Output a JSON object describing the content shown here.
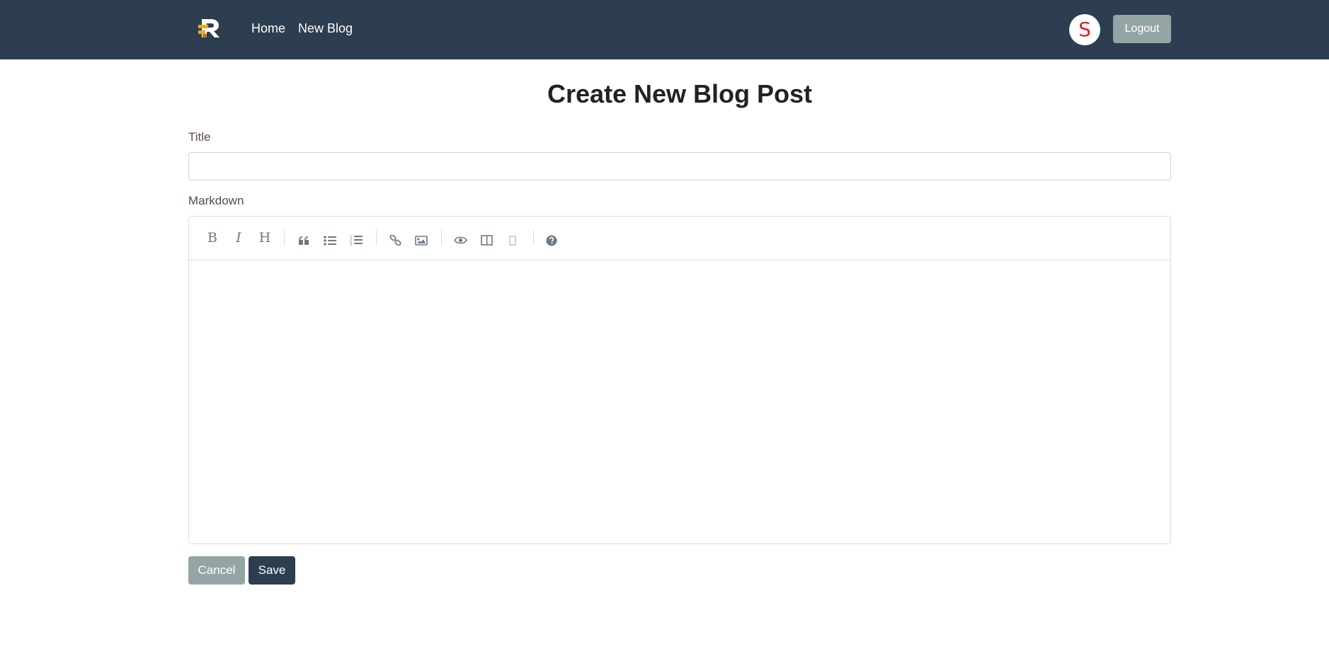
{
  "nav": {
    "logo_text": "R",
    "links": [
      "Home",
      "New Blog"
    ],
    "avatar_initial": "S",
    "logout_label": "Logout"
  },
  "page": {
    "title": "Create New Blog Post",
    "title_label": "Title",
    "title_value": "",
    "markdown_label": "Markdown",
    "markdown_value": ""
  },
  "toolbar": [
    {
      "name": "bold",
      "icon": "bold-icon"
    },
    {
      "name": "italic",
      "icon": "italic-icon"
    },
    {
      "name": "heading",
      "icon": "heading-icon"
    },
    {
      "name": "quote",
      "icon": "quote-icon"
    },
    {
      "name": "unordered-list",
      "icon": "unordered-list-icon"
    },
    {
      "name": "ordered-list",
      "icon": "ordered-list-icon"
    },
    {
      "name": "link",
      "icon": "link-icon"
    },
    {
      "name": "image",
      "icon": "image-icon"
    },
    {
      "name": "preview",
      "icon": "eye-icon"
    },
    {
      "name": "side-by-side",
      "icon": "columns-icon"
    },
    {
      "name": "fullscreen",
      "icon": "fullscreen-icon"
    },
    {
      "name": "guide",
      "icon": "question-icon"
    }
  ],
  "actions": {
    "cancel_label": "Cancel",
    "save_label": "Save"
  },
  "colors": {
    "navbar": "#2c3e50",
    "secondary": "#95a5a6",
    "primary": "#2c3e50",
    "avatar_text": "#e41e26",
    "logo_orange": "#f0a42a",
    "logo_white": "#ffffff"
  }
}
